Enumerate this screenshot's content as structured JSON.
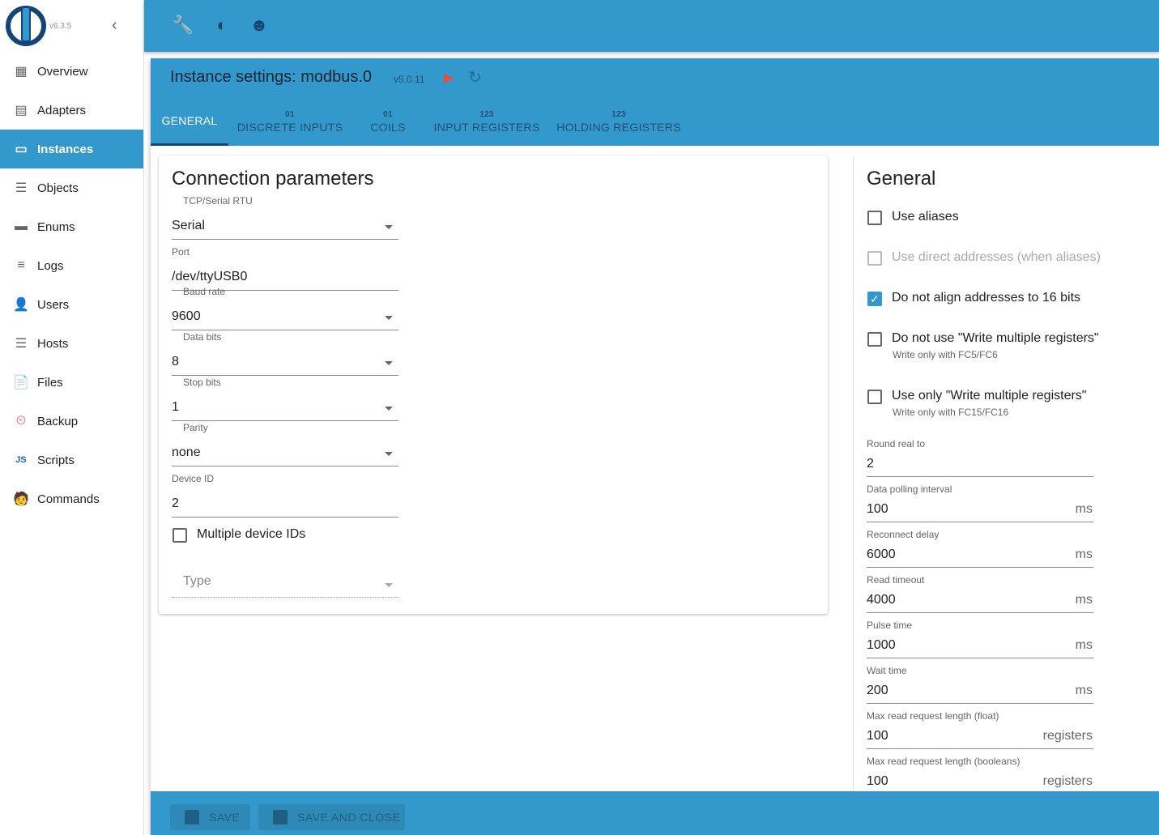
{
  "app": {
    "version": "v6.3.5"
  },
  "sidebar": {
    "items": [
      {
        "label": "Overview",
        "icon": "grid-icon"
      },
      {
        "label": "Adapters",
        "icon": "store-icon"
      },
      {
        "label": "Instances",
        "icon": "instances-icon",
        "active": true
      },
      {
        "label": "Objects",
        "icon": "list-icon"
      },
      {
        "label": "Enums",
        "icon": "enums-icon"
      },
      {
        "label": "Logs",
        "icon": "logs-icon"
      },
      {
        "label": "Users",
        "icon": "user-icon"
      },
      {
        "label": "Hosts",
        "icon": "hosts-icon"
      },
      {
        "label": "Files",
        "icon": "files-icon"
      },
      {
        "label": "Backup",
        "icon": "backup-icon"
      },
      {
        "label": "Scripts",
        "icon": "scripts-icon"
      },
      {
        "label": "Commands",
        "icon": "commands-icon"
      }
    ]
  },
  "dialog": {
    "title": "Instance settings: modbus.0",
    "version": "v5.0.11",
    "tabs": [
      {
        "label": "GENERAL",
        "badge": ""
      },
      {
        "label": "DISCRETE INPUTS",
        "badge": "01"
      },
      {
        "label": "COILS",
        "badge": "01"
      },
      {
        "label": "INPUT REGISTERS",
        "badge": "123"
      },
      {
        "label": "HOLDING REGISTERS",
        "badge": "123"
      }
    ]
  },
  "connection": {
    "title": "Connection parameters",
    "type_label": "TCP/Serial RTU",
    "type_value": "Serial",
    "port_label": "Port",
    "port_value": "/dev/ttyUSB0",
    "baud_label": "Baud rate",
    "baud_value": "9600",
    "databits_label": "Data bits",
    "databits_value": "8",
    "stopbits_label": "Stop bits",
    "stopbits_value": "1",
    "parity_label": "Parity",
    "parity_value": "none",
    "deviceid_label": "Device ID",
    "deviceid_value": "2",
    "multiple_label": "Multiple device IDs",
    "type2_placeholder": "Type"
  },
  "general": {
    "title": "General",
    "checks": [
      {
        "label": "Use aliases",
        "checked": false
      },
      {
        "label": "Use direct addresses (when aliases)",
        "checked": false,
        "disabled": true
      },
      {
        "label": "Do not align addresses to 16 bits",
        "checked": true
      },
      {
        "label": "Do not use \"Write multiple registers\"",
        "checked": false,
        "help": "Write only with FC5/FC6"
      },
      {
        "label": "Use only \"Write multiple registers\"",
        "checked": false,
        "help": "Write only with FC15/FC16"
      }
    ],
    "fields": [
      {
        "label": "Round real to",
        "value": "2",
        "unit": ""
      },
      {
        "label": "Data polling interval",
        "value": "100",
        "unit": "ms"
      },
      {
        "label": "Reconnect delay",
        "value": "6000",
        "unit": "ms"
      },
      {
        "label": "Read timeout",
        "value": "4000",
        "unit": "ms"
      },
      {
        "label": "Pulse time",
        "value": "1000",
        "unit": "ms"
      },
      {
        "label": "Wait time",
        "value": "200",
        "unit": "ms"
      },
      {
        "label": "Max read request length (float)",
        "value": "100",
        "unit": "registers"
      },
      {
        "label": "Max read request length (booleans)",
        "value": "100",
        "unit": "registers"
      }
    ]
  },
  "footer": {
    "save": "SAVE",
    "save_close": "SAVE AND CLOSE"
  },
  "colors": {
    "primary": "#3399cc",
    "dark": "#164477",
    "play": "#e74c3c"
  }
}
